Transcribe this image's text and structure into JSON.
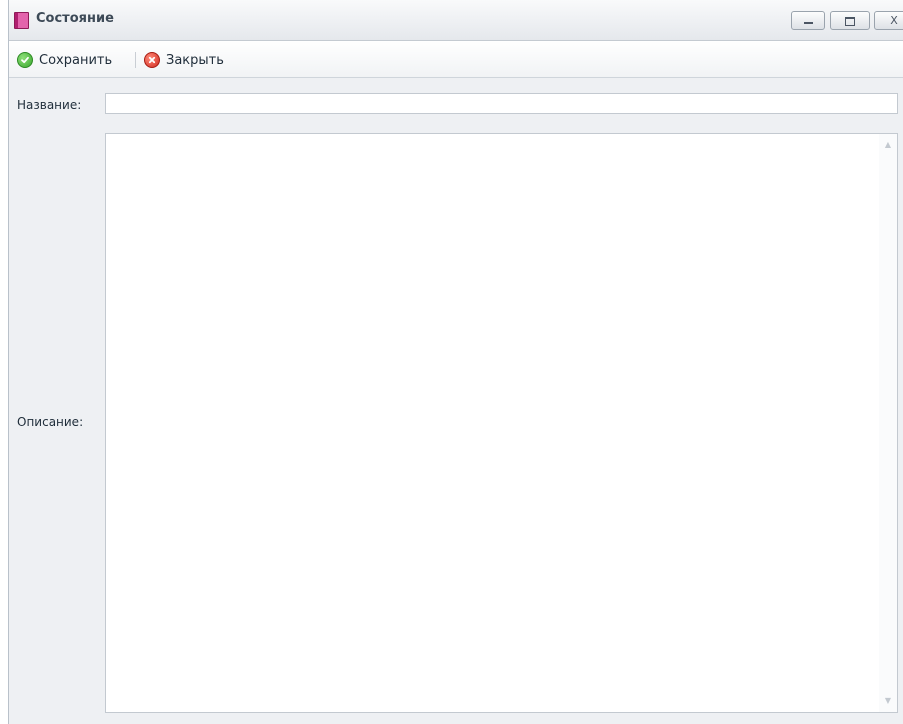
{
  "window": {
    "title": "Состояние",
    "icons": {
      "app": "book-icon",
      "minimize": "minimize-icon",
      "maximize": "maximize-icon",
      "close": "close-icon"
    },
    "close_glyph": "X"
  },
  "toolbar": {
    "save_label": "Сохранить",
    "close_label": "Закрыть",
    "save_icon": "check-circle-icon",
    "close_icon": "x-circle-icon"
  },
  "form": {
    "name_label": "Название:",
    "name_value": "",
    "description_label": "Описание:",
    "description_value": ""
  },
  "colors": {
    "save_icon": "#3aa62e",
    "close_icon": "#d12a1e",
    "app_icon": "#e364ac"
  }
}
